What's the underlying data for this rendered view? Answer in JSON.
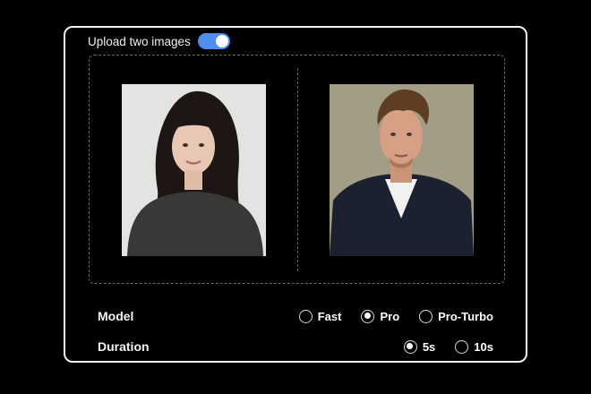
{
  "upload": {
    "label": "Upload two images",
    "toggle_on": true
  },
  "images": [
    {
      "alt": "portrait-woman"
    },
    {
      "alt": "portrait-man"
    }
  ],
  "model": {
    "label": "Model",
    "options": [
      "Fast",
      "Pro",
      "Pro-Turbo"
    ],
    "selected": "Pro"
  },
  "duration": {
    "label": "Duration",
    "options": [
      "5s",
      "10s"
    ],
    "selected": "5s"
  },
  "colors": {
    "accent": "#4d8ef0",
    "background": "#000000",
    "panel_border": "#f2f2f2"
  }
}
